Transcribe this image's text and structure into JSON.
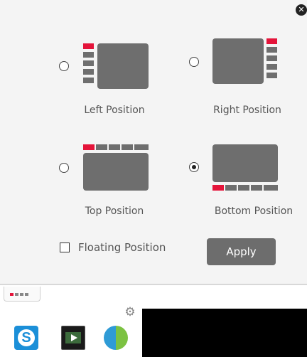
{
  "dialog": {
    "close_icon": "close-icon",
    "options": [
      {
        "id": "left",
        "label": "Left Position",
        "selected": false
      },
      {
        "id": "right",
        "label": "Right Position",
        "selected": false
      },
      {
        "id": "top",
        "label": "Top Position",
        "selected": false
      },
      {
        "id": "bottom",
        "label": "Bottom Position",
        "selected": true
      }
    ],
    "floating": {
      "label": "Floating Position",
      "checked": false
    },
    "apply_label": "Apply",
    "colors": {
      "accent": "#e4143a",
      "block": "#6e6e6e",
      "panel": "#f4f4f4"
    }
  },
  "taskbar": {
    "apps": [
      {
        "name": "skype-icon",
        "glyph": "S"
      },
      {
        "name": "media-player-icon"
      },
      {
        "name": "globe-icon"
      }
    ],
    "settings_icon": "gear-icon"
  }
}
